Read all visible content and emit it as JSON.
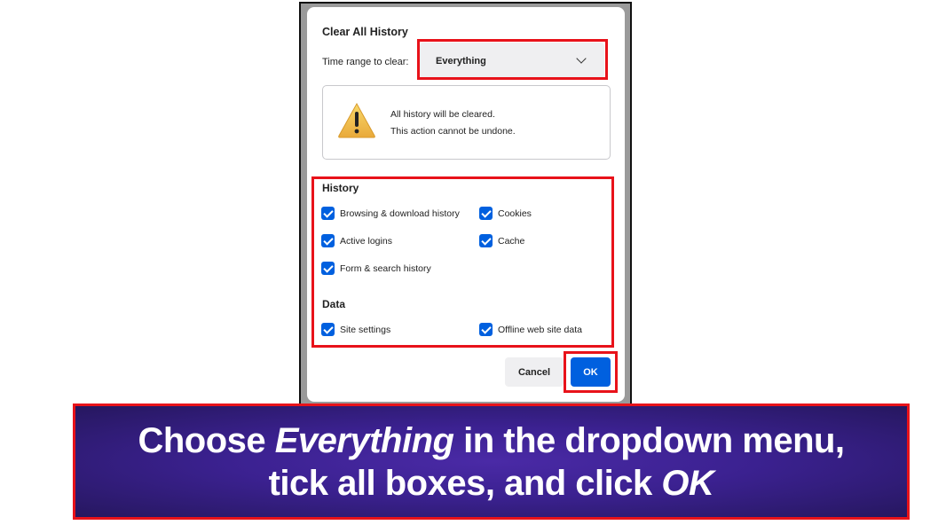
{
  "dialog": {
    "title": "Clear All History",
    "time_range_label": "Time range to clear:",
    "time_range_value": "Everything",
    "warning": {
      "icon": "warning-triangle-icon",
      "line1": "All history will be cleared.",
      "line2": "This action cannot be undone."
    },
    "history_section": {
      "heading": "History",
      "items": [
        {
          "label": "Browsing & download history",
          "checked": true
        },
        {
          "label": "Cookies",
          "checked": true
        },
        {
          "label": "Active logins",
          "checked": true
        },
        {
          "label": "Cache",
          "checked": true
        },
        {
          "label": "Form & search history",
          "checked": true
        }
      ]
    },
    "data_section": {
      "heading": "Data",
      "items": [
        {
          "label": "Site settings",
          "checked": true
        },
        {
          "label": "Offline web site data",
          "checked": true
        }
      ]
    },
    "buttons": {
      "cancel": "Cancel",
      "ok": "OK"
    }
  },
  "banner": {
    "line1_pre": "Choose ",
    "line1_em": "Everything",
    "line1_post": " in the dropdown menu,",
    "line2_pre": "tick all boxes, and click ",
    "line2_em": "OK"
  },
  "colors": {
    "highlight": "#e8121a",
    "accent": "#0060df",
    "banner_bg": "#3b2190"
  }
}
